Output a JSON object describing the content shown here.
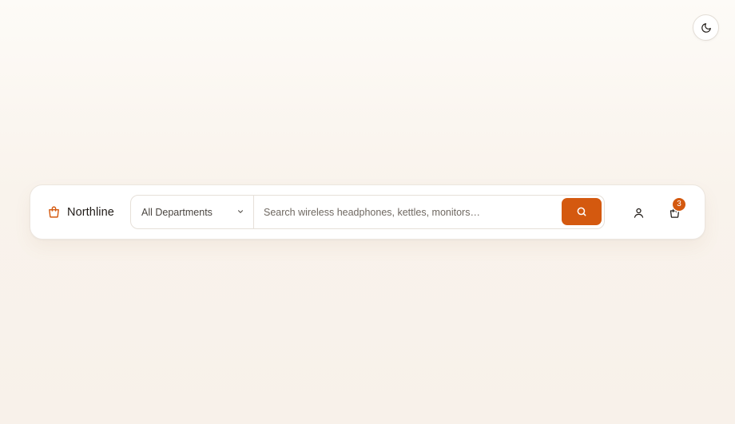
{
  "theme_toggle": {
    "icon": "moon-icon"
  },
  "brand": {
    "name": "Northline",
    "icon": "shopping-bag-icon",
    "accent": "#d4590f"
  },
  "search": {
    "department_selected": "All Departments",
    "placeholder": "Search wireless headphones, kettles, monitors…",
    "value": "",
    "button_icon": "search-icon"
  },
  "actions": {
    "account_icon": "user-icon",
    "cart_icon": "cart-icon",
    "cart_count": "3"
  }
}
